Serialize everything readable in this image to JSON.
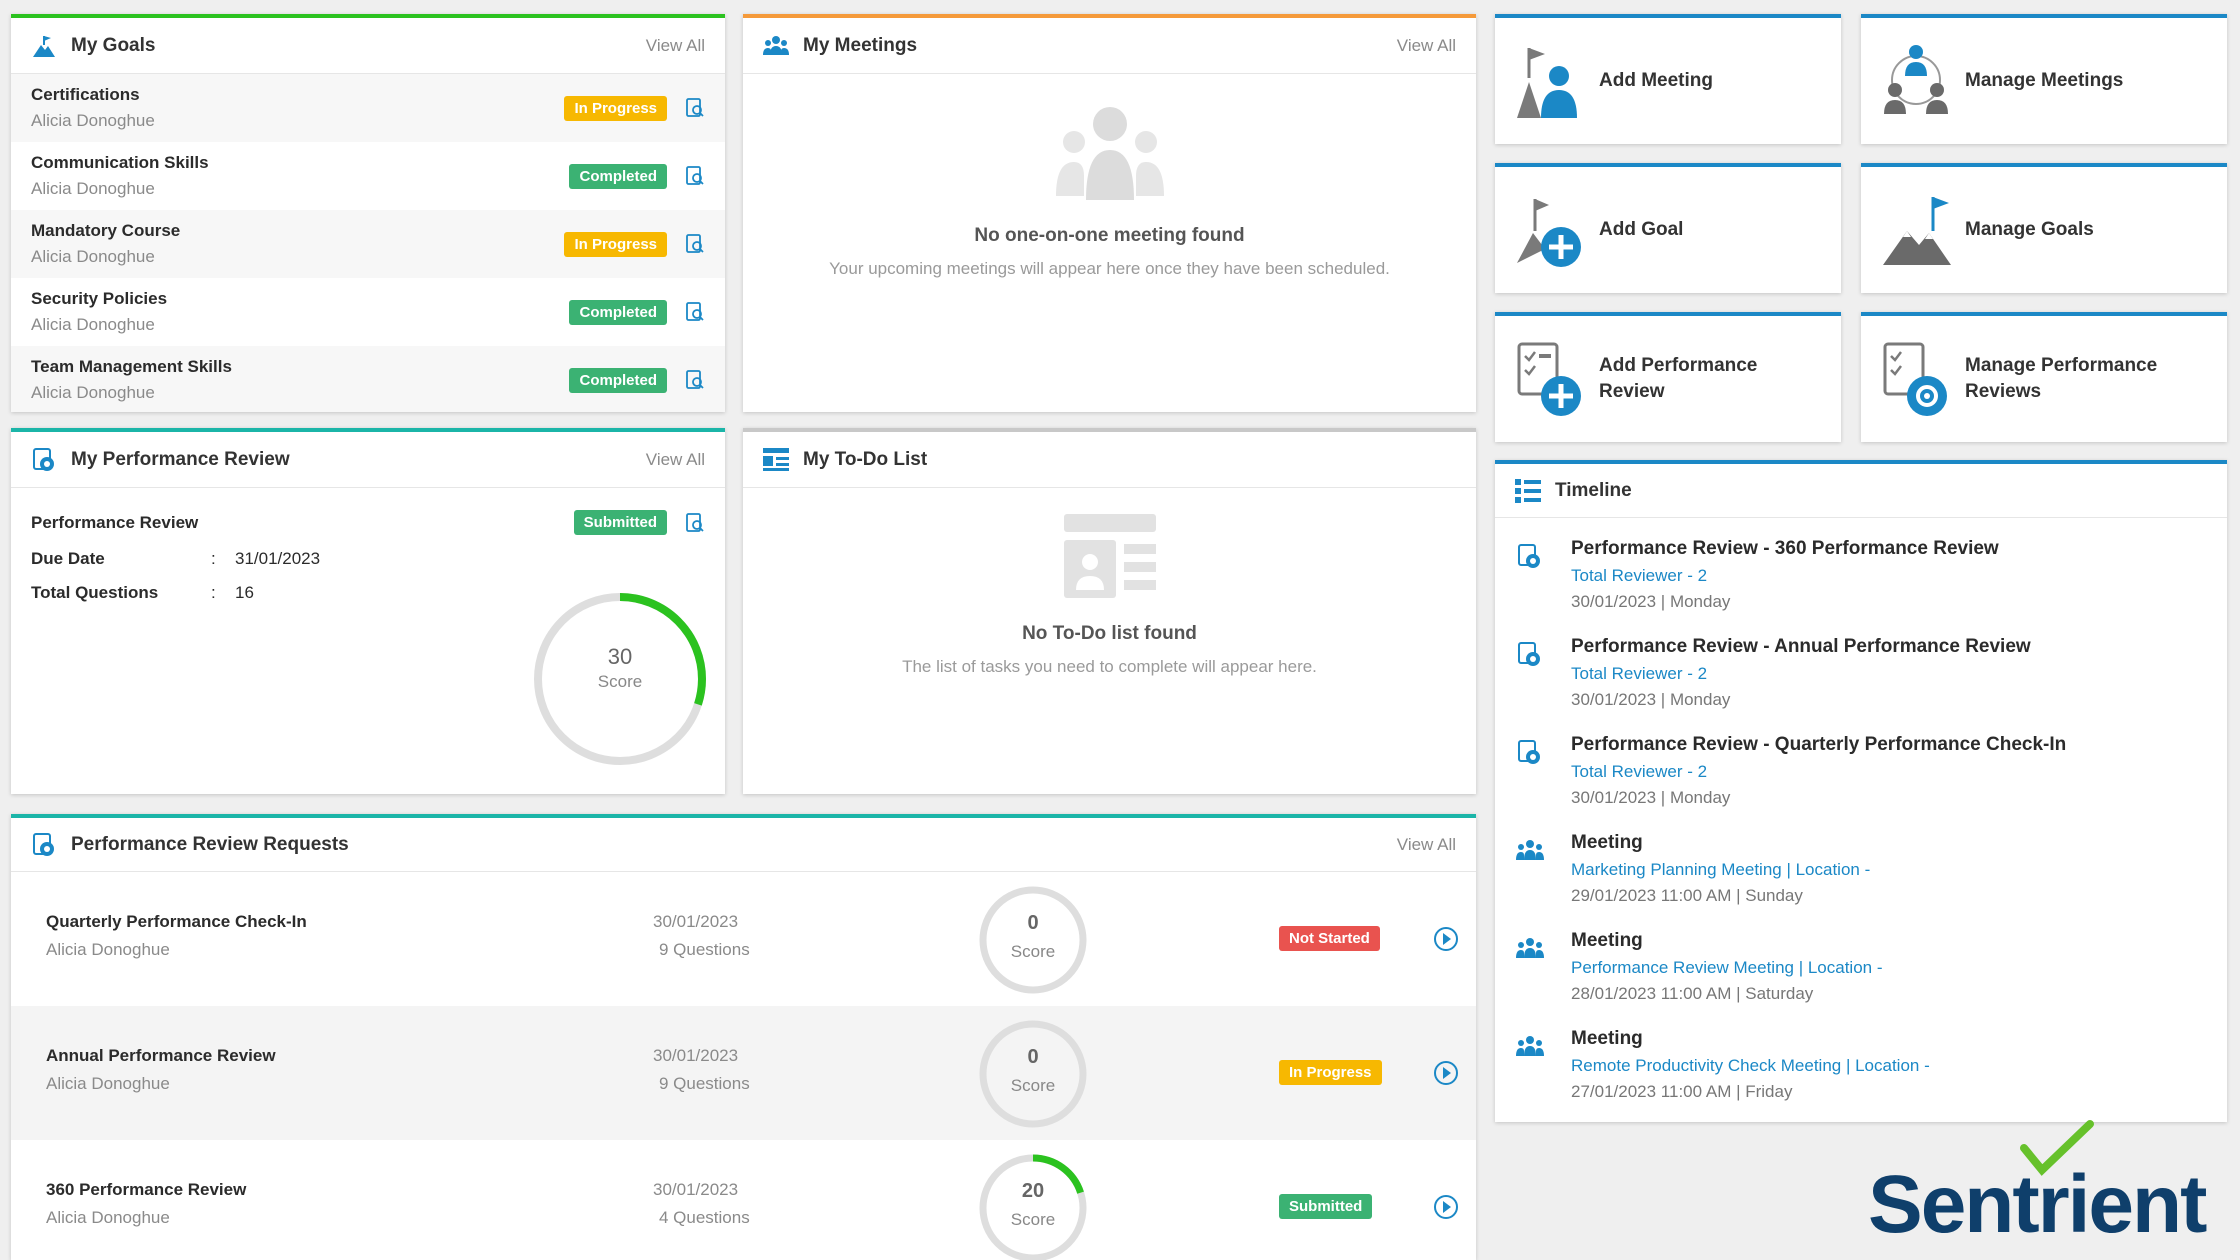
{
  "goals": {
    "title": "My Goals",
    "view_all": "View All",
    "items": [
      {
        "name": "Certifications",
        "owner": "Alicia Donoghue",
        "status": "In Progress",
        "kind": "progress"
      },
      {
        "name": "Communication Skills",
        "owner": "Alicia Donoghue",
        "status": "Completed",
        "kind": "completed"
      },
      {
        "name": "Mandatory Course",
        "owner": "Alicia Donoghue",
        "status": "In Progress",
        "kind": "progress"
      },
      {
        "name": "Security Policies",
        "owner": "Alicia Donoghue",
        "status": "Completed",
        "kind": "completed"
      },
      {
        "name": "Team Management Skills",
        "owner": "Alicia Donoghue",
        "status": "Completed",
        "kind": "completed"
      }
    ]
  },
  "meetings": {
    "title": "My Meetings",
    "view_all": "View All",
    "empty_title": "No one-on-one meeting found",
    "empty_sub": "Your upcoming meetings will appear here once they have been scheduled."
  },
  "review": {
    "title": "My Performance Review",
    "view_all": "View All",
    "name": "Performance Review",
    "status": "Submitted",
    "due_label": "Due Date",
    "due_value": "31/01/2023",
    "questions_label": "Total Questions",
    "questions_value": "16",
    "score": "30",
    "score_label": "Score",
    "score_fraction": 0.3
  },
  "todo": {
    "title": "My To-Do List",
    "empty_title": "No To-Do list found",
    "empty_sub": "The list of tasks you need to complete will appear here."
  },
  "requests": {
    "title": "Performance Review Requests",
    "view_all": "View All",
    "items": [
      {
        "name": "Quarterly Performance Check-In",
        "owner": "Alicia Donoghue",
        "date": "30/01/2023",
        "questions": "9 Questions",
        "score": "0",
        "score_label": "Score",
        "fraction": 0,
        "status": "Not Started",
        "kind": "notstarted"
      },
      {
        "name": "Annual Performance Review",
        "owner": "Alicia Donoghue",
        "date": "30/01/2023",
        "questions": "9 Questions",
        "score": "0",
        "score_label": "Score",
        "fraction": 0,
        "status": "In Progress",
        "kind": "progress"
      },
      {
        "name": "360 Performance Review",
        "owner": "Alicia Donoghue",
        "date": "30/01/2023",
        "questions": "4 Questions",
        "score": "20",
        "score_label": "Score",
        "fraction": 0.2,
        "status": "Submitted",
        "kind": "submitted"
      }
    ]
  },
  "tiles": {
    "add_meeting": "Add Meeting",
    "manage_meetings": "Manage Meetings",
    "add_goal": "Add Goal",
    "manage_goals": "Manage Goals",
    "add_review_1": "Add Performance",
    "add_review_2": "Review",
    "manage_reviews_1": "Manage Performance",
    "manage_reviews_2": "Reviews"
  },
  "timeline": {
    "title": "Timeline",
    "items": [
      {
        "type": "review",
        "title": "Performance Review - 360 Performance Review",
        "link": "Total Reviewer - 2",
        "date": "30/01/2023 | Monday"
      },
      {
        "type": "review",
        "title": "Performance Review - Annual Performance Review",
        "link": "Total Reviewer - 2",
        "date": "30/01/2023 | Monday"
      },
      {
        "type": "review",
        "title": "Performance Review - Quarterly Performance Check-In",
        "link": "Total Reviewer - 2",
        "date": "30/01/2023 | Monday"
      },
      {
        "type": "meeting",
        "title": "Meeting",
        "link": "Marketing Planning Meeting | Location -",
        "date": "29/01/2023 11:00 AM | Sunday"
      },
      {
        "type": "meeting",
        "title": "Meeting",
        "link": "Performance Review Meeting | Location -",
        "date": "28/01/2023 11:00 AM | Saturday"
      },
      {
        "type": "meeting",
        "title": "Meeting",
        "link": "Remote Productivity Check Meeting | Location -",
        "date": "27/01/2023 11:00 AM | Friday"
      }
    ]
  },
  "brand": {
    "logo_text": "Sentrient"
  },
  "colors": {
    "accent_blue": "#1b88c6",
    "green": "#3bb273",
    "orange": "#f7b801",
    "red": "#e9534f",
    "brand_navy": "#0f3f6b",
    "ring_green": "#2bc21f"
  }
}
